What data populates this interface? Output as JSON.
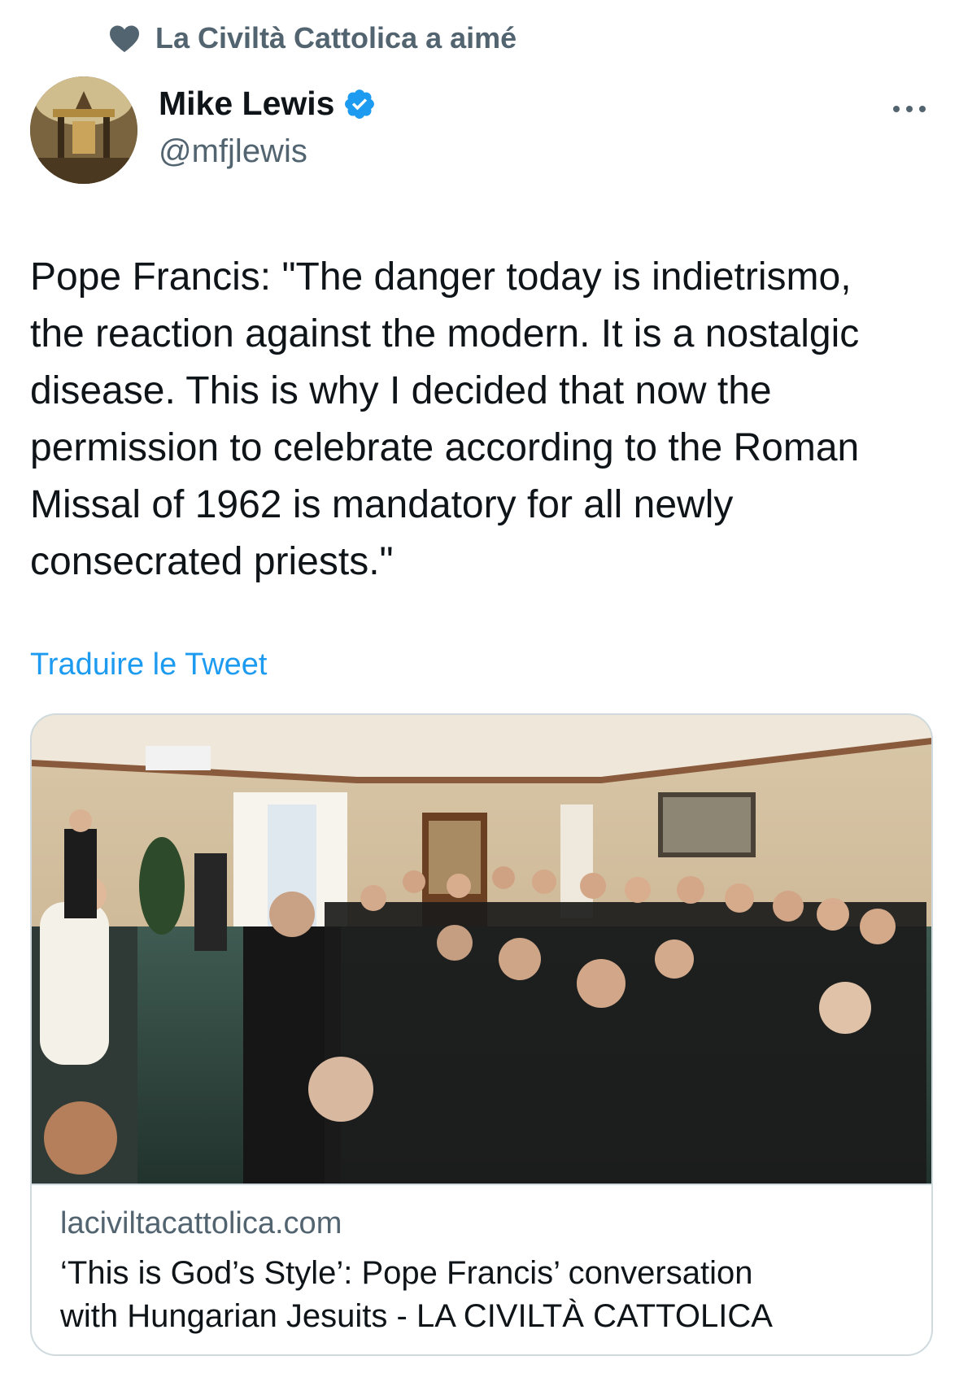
{
  "social_context": {
    "icon": "heart-icon",
    "text": "La Civiltà Cattolica a aimé"
  },
  "author": {
    "name": "Mike Lewis",
    "handle": "@mfjlewis",
    "verified": true,
    "avatar": "avatar-image"
  },
  "tweet": {
    "text": "Pope Francis: \"The danger today is indietrismo,\nthe reaction against the modern. It is a nostalgic\ndisease. This is why I decided that now the\npermission to celebrate according to the Roman\nMissal of 1962 is mandatory for all newly\nconsecrated priests.\"",
    "translate_label": "Traduire le Tweet"
  },
  "card": {
    "domain": "laciviltacattolica.com",
    "title": "‘This is God’s Style’: Pope Francis’ conversation\nwith Hungarian Jesuits - LA CIVILTÀ CATTOLICA"
  },
  "colors": {
    "accent": "#1d9bf0",
    "secondary_text": "#536471",
    "border": "#cfd9de"
  }
}
